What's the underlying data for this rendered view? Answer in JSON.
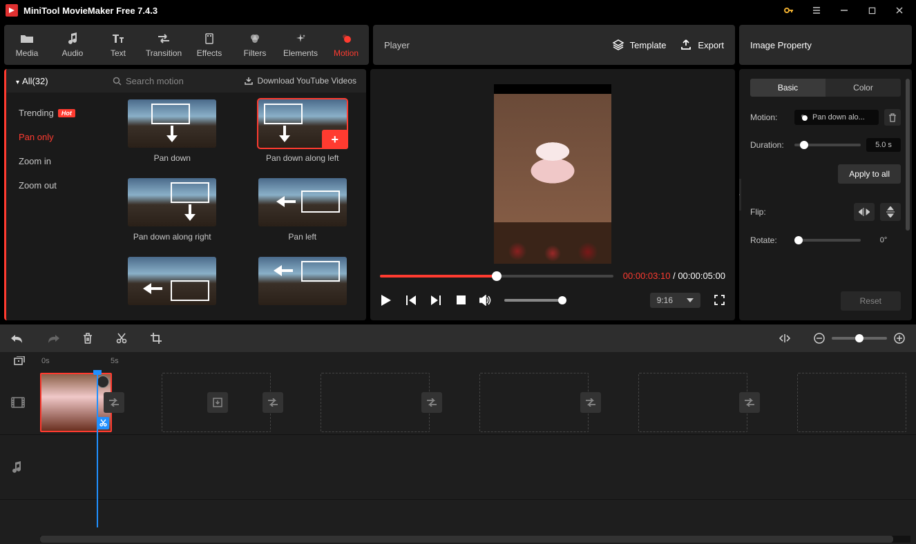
{
  "app": {
    "title": "MiniTool MovieMaker Free 7.4.3"
  },
  "toolbar": [
    {
      "label": "Media",
      "name": "media-tab"
    },
    {
      "label": "Audio",
      "name": "audio-tab"
    },
    {
      "label": "Text",
      "name": "text-tab"
    },
    {
      "label": "Transition",
      "name": "transition-tab"
    },
    {
      "label": "Effects",
      "name": "effects-tab"
    },
    {
      "label": "Filters",
      "name": "filters-tab"
    },
    {
      "label": "Elements",
      "name": "elements-tab"
    },
    {
      "label": "Motion",
      "name": "motion-tab",
      "active": true
    }
  ],
  "player_header": {
    "title": "Player",
    "template": "Template",
    "export": "Export"
  },
  "prop_header": {
    "title": "Image Property"
  },
  "motion_panel": {
    "all_label": "All(32)",
    "search_placeholder": "Search motion",
    "download_label": "Download YouTube Videos",
    "categories": [
      {
        "label": "Trending",
        "hot": true
      },
      {
        "label": "Pan only",
        "active": true
      },
      {
        "label": "Zoom in"
      },
      {
        "label": "Zoom out"
      }
    ],
    "items": [
      {
        "label": "Pan down"
      },
      {
        "label": "Pan down along left",
        "selected": true
      },
      {
        "label": "Pan down along right"
      },
      {
        "label": "Pan left"
      },
      {
        "label": ""
      },
      {
        "label": ""
      }
    ]
  },
  "player": {
    "current": "00:00:03:10",
    "sep": " / ",
    "total": "00:00:05:00",
    "ratio": "9:16"
  },
  "props": {
    "tabs": {
      "basic": "Basic",
      "color": "Color"
    },
    "motion_label": "Motion:",
    "motion_value": "Pan down alo...",
    "duration_label": "Duration:",
    "duration_value": "5.0 s",
    "apply_all": "Apply to all",
    "flip_label": "Flip:",
    "rotate_label": "Rotate:",
    "rotate_value": "0°",
    "reset": "Reset"
  },
  "timeline": {
    "ticks": [
      "0s",
      "5s"
    ]
  }
}
